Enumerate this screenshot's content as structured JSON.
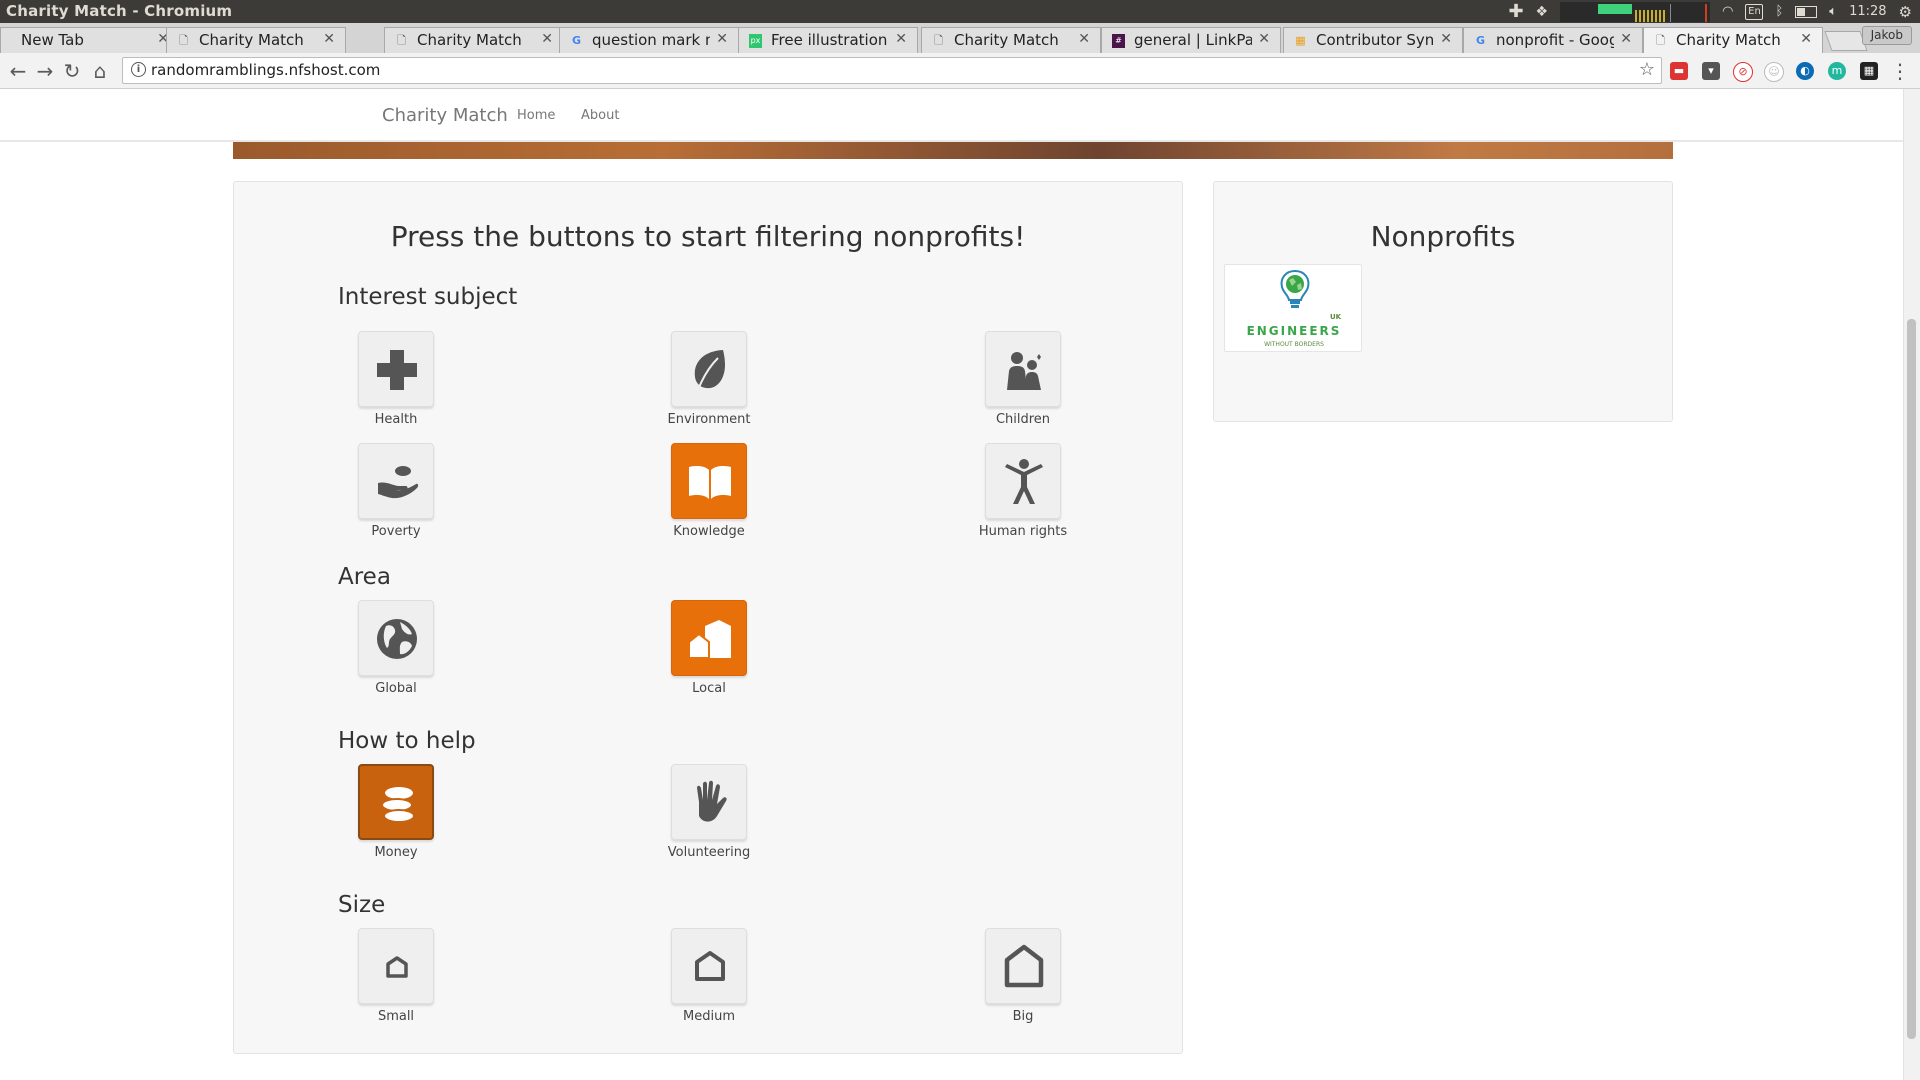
{
  "os": {
    "window_title": "Charity Match - Chromium",
    "clock": "11:28",
    "lang": "En"
  },
  "browser": {
    "tabs": [
      {
        "label": "New Tab",
        "favicon": "blank-icon",
        "active": false
      },
      {
        "label": "Charity Match",
        "favicon": "page-icon",
        "active": false
      },
      {
        "label": "Charity Match",
        "favicon": "page-icon",
        "active": false
      },
      {
        "label": "question mark m…",
        "favicon": "google-icon",
        "active": false
      },
      {
        "label": "Free illustration:",
        "favicon": "pixabay-icon",
        "active": false
      },
      {
        "label": "Charity Match",
        "favicon": "page-icon",
        "active": false
      },
      {
        "label": "general | LinkPac",
        "favicon": "slack-icon",
        "active": false
      },
      {
        "label": "Contributor Sync",
        "favicon": "grid-icon",
        "active": false
      },
      {
        "label": "nonprofit - Googl",
        "favicon": "google-icon",
        "active": false
      },
      {
        "label": "Charity Match",
        "favicon": "page-icon",
        "active": true
      }
    ],
    "profile_name": "Jakob",
    "url": "randomramblings.nfshost.com"
  },
  "site": {
    "brand": "Charity Match",
    "nav": [
      "Home",
      "About"
    ]
  },
  "filters": {
    "heading": "Press the buttons to start filtering nonprofits!",
    "sections": [
      {
        "title": "Interest subject",
        "buttons": [
          {
            "label": "Health",
            "icon": "cross-icon",
            "state": "off"
          },
          {
            "label": "Environment",
            "icon": "leaf-icon",
            "state": "off"
          },
          {
            "label": "Children",
            "icon": "children-icon",
            "state": "off"
          },
          {
            "label": "Poverty",
            "icon": "hand-coin-icon",
            "state": "off"
          },
          {
            "label": "Knowledge",
            "icon": "book-icon",
            "state": "on"
          },
          {
            "label": "Human rights",
            "icon": "person-icon",
            "state": "off"
          }
        ]
      },
      {
        "title": "Area",
        "buttons": [
          {
            "label": "Global",
            "icon": "globe-icon",
            "state": "off"
          },
          {
            "label": "Local",
            "icon": "houses-icon",
            "state": "on"
          }
        ]
      },
      {
        "title": "How to help",
        "buttons": [
          {
            "label": "Money",
            "icon": "coins-icon",
            "state": "pressed"
          },
          {
            "label": "Volunteering",
            "icon": "hand-icon",
            "state": "off"
          }
        ]
      },
      {
        "title": "Size",
        "buttons": [
          {
            "label": "Small",
            "icon": "house-small-icon",
            "state": "off"
          },
          {
            "label": "Medium",
            "icon": "house-medium-icon",
            "state": "off"
          },
          {
            "label": "Big",
            "icon": "house-big-icon",
            "state": "off"
          }
        ]
      }
    ]
  },
  "results": {
    "heading": "Nonprofits",
    "items": [
      {
        "name": "ENGINEERS",
        "tagline": "WITHOUT BORDERS",
        "region": "UK"
      }
    ]
  },
  "colors": {
    "accent": "#e8700a",
    "icon_gray": "#555555"
  }
}
